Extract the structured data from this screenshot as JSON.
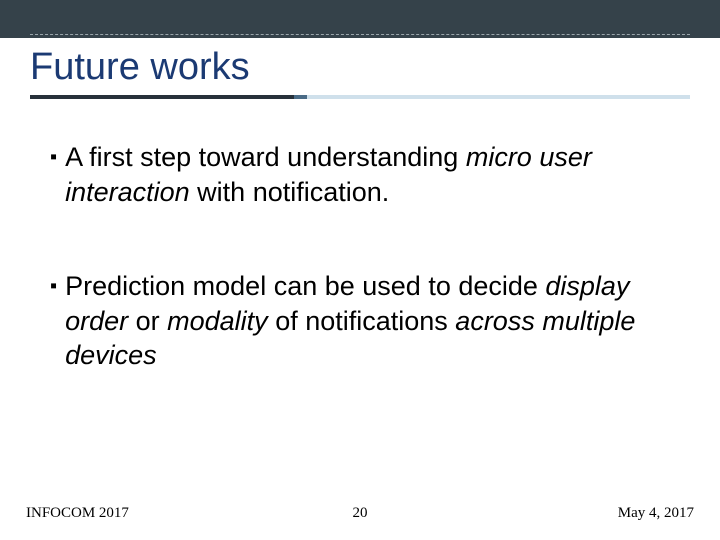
{
  "slide": {
    "title": "Future works"
  },
  "bullets": [
    {
      "runs": [
        {
          "text": "A first step toward understanding ",
          "style": ""
        },
        {
          "text": "micro user interaction",
          "style": "ital"
        },
        {
          "text": " with notification.",
          "style": ""
        }
      ]
    },
    {
      "runs": [
        {
          "text": "Prediction model can be used to decide ",
          "style": ""
        },
        {
          "text": "display order",
          "style": "ital"
        },
        {
          "text": " or ",
          "style": ""
        },
        {
          "text": "modality",
          "style": "ital"
        },
        {
          "text": " of notifications ",
          "style": ""
        },
        {
          "text": "across multiple devices",
          "style": "ital"
        }
      ]
    }
  ],
  "footer": {
    "left": "INFOCOM 2017",
    "page": "20",
    "right": "May 4, 2017"
  }
}
